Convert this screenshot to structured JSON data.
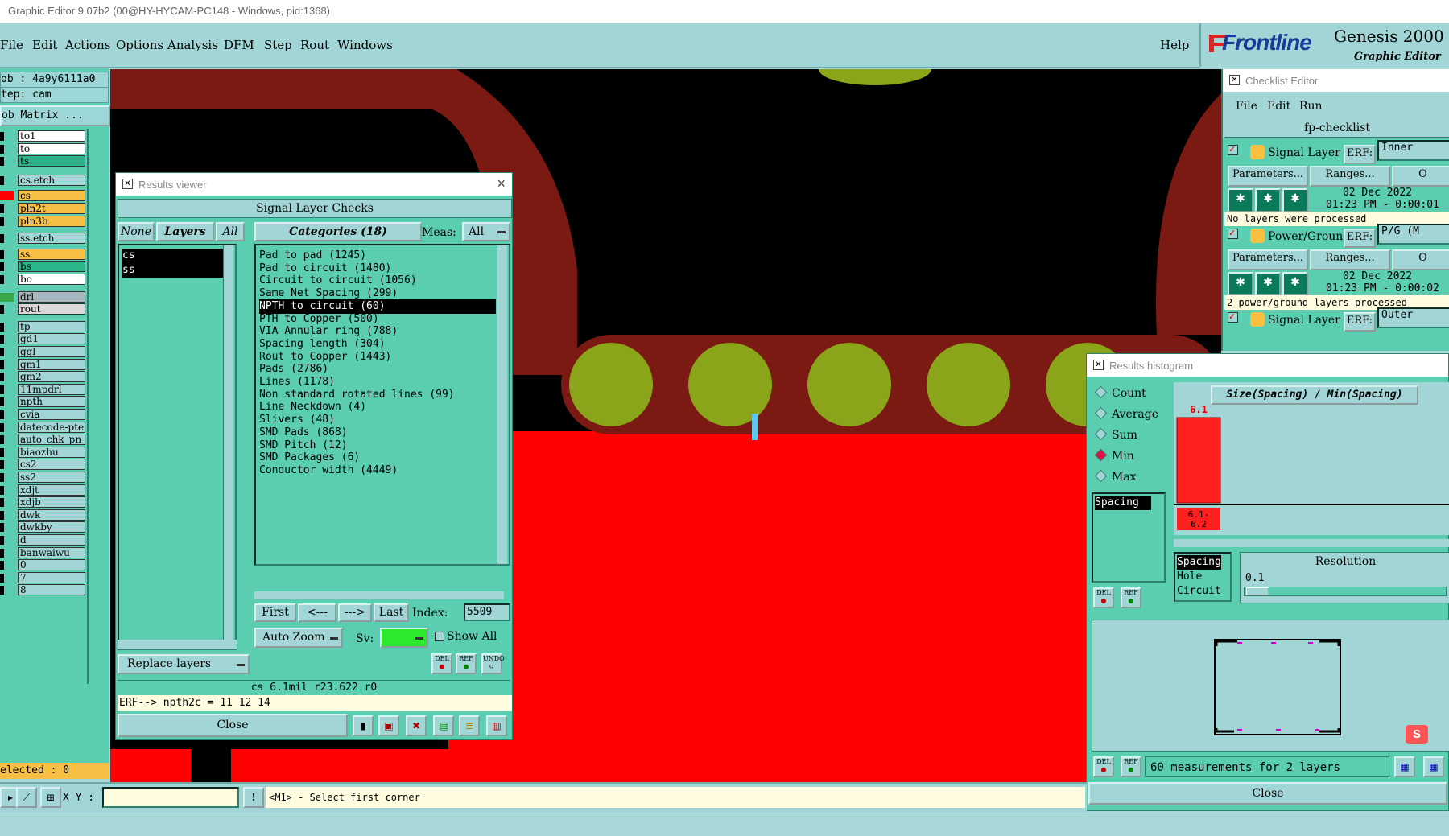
{
  "window": {
    "title": "Graphic Editor 9.07b2 (00@HY-HYCAM-PC148 - Windows, pid:1368)"
  },
  "menu": {
    "items": [
      "File",
      "Edit",
      "Actions",
      "Options",
      "Analysis",
      "DFM",
      "Step",
      "Rout",
      "Windows"
    ],
    "help": "Help"
  },
  "brand": {
    "logo": "Frontline",
    "product": "Genesis 2000",
    "subtitle": "Graphic Editor"
  },
  "left": {
    "job": "ob : 4a9y6111a0",
    "step": "tep: cam",
    "matrix_button": "ob Matrix ...",
    "layers": [
      "to1",
      "to",
      "ts",
      "cs.etch",
      "cs",
      "pln2t",
      "pln3b",
      "ss.etch",
      "ss",
      "bs",
      "bo",
      "drl",
      "rout",
      "tp",
      "gd1",
      "ggl",
      "gm1",
      "gm2",
      "11mpdrl",
      "npth",
      "cvia",
      "datecode-pte",
      "auto_chk_pn",
      "biaozhu",
      "cs2",
      "ss2",
      "xdjt",
      "xdjb",
      "dwk",
      "dwkby",
      "d",
      "banwaiwu",
      "0",
      "7",
      "8"
    ],
    "selected": "elected : 0"
  },
  "results_viewer": {
    "title": "Results viewer",
    "heading": "Signal Layer Checks",
    "none": "None",
    "layers_btn": "Layers",
    "all": "All",
    "categories_btn": "Categories (18)",
    "meas_label": "Meas:",
    "meas_value": "All",
    "layer_list": [
      "cs",
      "ss"
    ],
    "categories": [
      "Pad to pad (1245)",
      "Pad to circuit (1480)",
      "Circuit to circuit (1056)",
      "Same Net Spacing (299)",
      "NPTH to circuit (60)",
      "PTH to Copper (500)",
      "VIA Annular ring (788)",
      "Spacing length (304)",
      "Rout to Copper (1443)",
      "Pads (2786)",
      "Lines (1178)",
      "Non standard rotated lines (99)",
      "Line Neckdown (4)",
      "Slivers (48)",
      "SMD Pads (868)",
      "SMD Pitch (12)",
      "SMD Packages (6)",
      "Conductor width (4449)"
    ],
    "first": "First",
    "prev": "<---",
    "next": "--->",
    "last": "Last",
    "index_label": "Index:",
    "index_value": "5509",
    "auto_zoom": "Auto Zoom",
    "sv_label": "Sv:",
    "show_all": "Show All",
    "replace_layers": "Replace layers",
    "del": "DEL",
    "ref": "REF",
    "undo": "UNDO",
    "status": "cs 6.1mil  r23.622  r0",
    "erf": "ERF--> npth2c = 11 12 14",
    "close": "Close"
  },
  "checklist": {
    "title": "Checklist Editor",
    "menu": [
      "File",
      "Edit",
      "Run"
    ],
    "name": "fp-checklist",
    "items": [
      {
        "name": "Signal Layer Ch",
        "erf_label": "ERF:",
        "erf": "Inner",
        "params": "Parameters...",
        "ranges": "Ranges...",
        "o": "O",
        "date": "02 Dec 2022",
        "time": "01:23 PM - 0:00:01",
        "msg": "No layers were processed"
      },
      {
        "name": "Power/Ground C",
        "erf_label": "ERF:",
        "erf": "P/G (M",
        "params": "Parameters...",
        "ranges": "Ranges...",
        "o": "O",
        "date": "02 Dec 2022",
        "time": "01:23 PM - 0:00:02",
        "msg": "2 power/ground layers processed"
      },
      {
        "name": "Signal Layer Ch",
        "erf_label": "ERF:",
        "erf": "Outer"
      }
    ]
  },
  "histogram": {
    "title": "Results histogram",
    "modes": [
      "Count",
      "Average",
      "Sum",
      "Min",
      "Max"
    ],
    "selected_mode": "Min",
    "measure_list": [
      "Spacing"
    ],
    "chart_title": "Size(Spacing) / Min(Spacing)",
    "bar_value": "6.1",
    "bar_range": "6.1-\n6.2",
    "types": [
      "Spacing",
      "Hole",
      "Circuit"
    ],
    "resolution_label": "Resolution",
    "resolution_value": "0.1",
    "summary": "60 measurements for 2 layers",
    "close": "Close",
    "chart_data": {
      "type": "bar",
      "categories": [
        "6.1-6.2"
      ],
      "values": [
        60
      ],
      "title": "Size(Spacing) / Min(Spacing)"
    }
  },
  "bottom": {
    "xy_label": "X Y :",
    "prompt": "<M1> - Select first corner"
  },
  "colors": {
    "panel": "#5bcdb0",
    "menubar": "#a2d6d6",
    "copper_red": "#ff0000",
    "dark_red": "#7a1a12",
    "pad_green": "#8aa51a"
  }
}
